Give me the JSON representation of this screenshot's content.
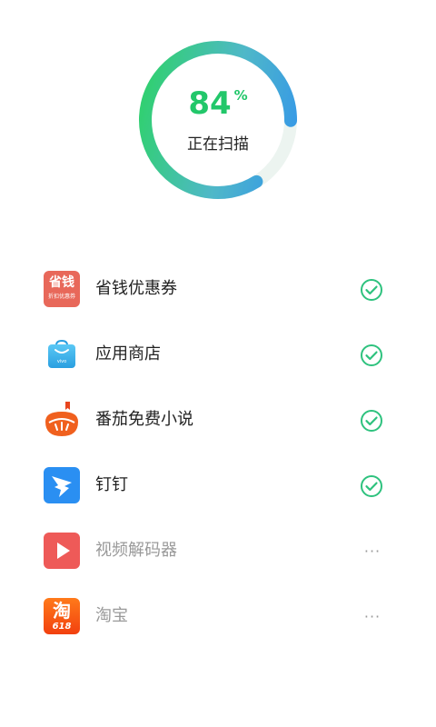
{
  "scan": {
    "progress_value": "84",
    "progress_unit": "%",
    "progress_fraction": 0.84,
    "status_text": "正在扫描",
    "colors": {
      "track_start": "#29d65a",
      "track_mid": "#4fb8c8",
      "track_end": "#2f8ff0",
      "percent_text": "#22c76a"
    }
  },
  "apps": [
    {
      "name": "省钱优惠券",
      "icon": "coupon-app-icon",
      "icon_text": "省钱",
      "icon_subtext": "折扣优惠券",
      "status": "done"
    },
    {
      "name": "应用商店",
      "icon": "app-store-icon",
      "icon_text": "vivo",
      "status": "done"
    },
    {
      "name": "番茄免费小说",
      "icon": "tomato-novel-icon",
      "status": "done"
    },
    {
      "name": "钉钉",
      "icon": "dingtalk-icon",
      "status": "done"
    },
    {
      "name": "视频解码器",
      "icon": "video-decoder-icon",
      "status": "pending"
    },
    {
      "name": "淘宝",
      "icon": "taobao-icon",
      "icon_text": "淘",
      "icon_subtext": "618",
      "status": "pending"
    }
  ],
  "status_icons": {
    "done": "check-circle-icon",
    "pending": "more-dots-icon",
    "done_color": "#2ec27e",
    "pending_glyph": "···"
  }
}
